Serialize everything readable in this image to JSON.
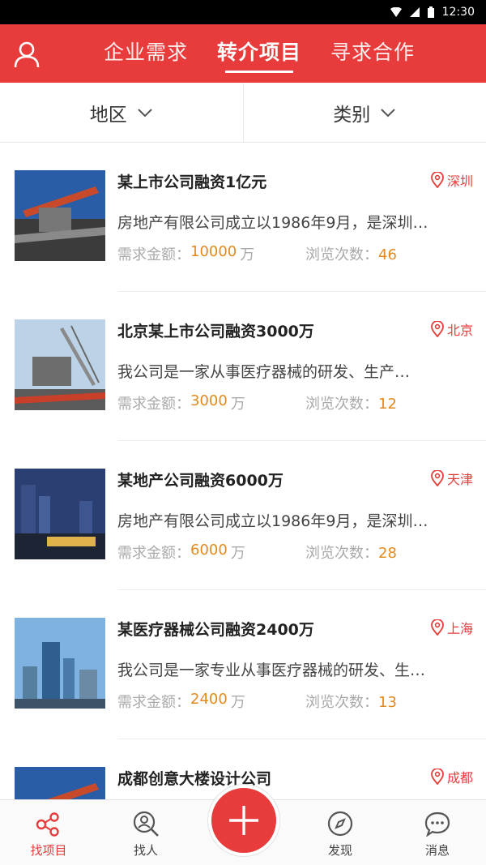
{
  "status_bar": {
    "time": "12:30"
  },
  "header": {
    "tabs": [
      {
        "label": "企业需求"
      },
      {
        "label": "转介项目"
      },
      {
        "label": "寻求合作"
      }
    ],
    "active_tab": 1
  },
  "filters": {
    "region": "地区",
    "category": "类别"
  },
  "labels": {
    "amount": "需求金额：",
    "views": "浏览次数：",
    "unit": "万"
  },
  "items": [
    {
      "title": "某上市公司融资1亿元",
      "location": "深圳",
      "desc": "房地产有限公司成立以1986年9月，是深圳…",
      "amount": "10000",
      "views": "46",
      "thumb": "crane-construction"
    },
    {
      "title": "北京某上市公司融资3000万",
      "location": "北京",
      "desc": "我公司是一家从事医疗器械的研发、生产…",
      "amount": "3000",
      "views": "12",
      "thumb": "crane-lift"
    },
    {
      "title": "某地产公司融资6000万",
      "location": "天津",
      "desc": "房地产有限公司成立以1986年9月，是深圳…",
      "amount": "6000",
      "views": "28",
      "thumb": "city-night"
    },
    {
      "title": "某医疗器械公司融资2400万",
      "location": "上海",
      "desc": "我公司是一家专业从事医疗器械的研发、生…",
      "amount": "2400",
      "views": "13",
      "thumb": "city-day"
    },
    {
      "title": "成都创意大楼设计公司",
      "location": "成都",
      "desc": "",
      "amount": "",
      "views": "",
      "thumb": "crane-construction"
    }
  ],
  "bottom_nav": {
    "items": [
      {
        "label": "找项目",
        "icon": "project-icon"
      },
      {
        "label": "找人",
        "icon": "search-person-icon"
      },
      {
        "label": "发现",
        "icon": "compass-icon"
      },
      {
        "label": "消息",
        "icon": "message-icon"
      }
    ]
  },
  "colors": {
    "accent": "#e83b3b",
    "value": "#e38a1f"
  }
}
